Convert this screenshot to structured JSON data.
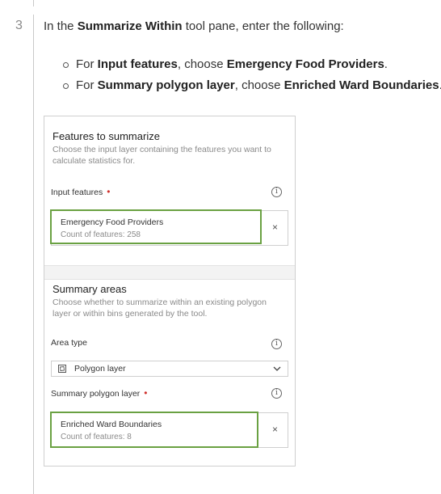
{
  "step": {
    "number": "3",
    "instruction_pre": "In the ",
    "instruction_bold": "Summarize Within",
    "instruction_post": " tool pane, enter the following:",
    "bullets": [
      {
        "pre": "For ",
        "bold1": "Input features",
        "mid": ", choose ",
        "bold2": "Emergency Food Providers",
        "post": "."
      },
      {
        "pre": "For ",
        "bold1": "Summary polygon layer",
        "mid": ", choose ",
        "bold2": "Enriched Ward Boundaries",
        "post": "."
      }
    ]
  },
  "pane": {
    "features_section": {
      "title": "Features to summarize",
      "description": "Choose the input layer containing the features you want to calculate statistics for.",
      "input_label": "Input features",
      "required_mark": "•",
      "input_value": {
        "name": "Emergency Food Providers",
        "count": "Count of features: 258"
      },
      "clear_symbol": "×"
    },
    "summary_section": {
      "title": "Summary areas",
      "description": "Choose whether to summarize within an existing polygon layer or within bins generated by the tool.",
      "area_type_label": "Area type",
      "area_type_value": "Polygon layer",
      "polygon_label": "Summary polygon layer",
      "required_mark": "•",
      "polygon_value": {
        "name": "Enriched Ward Boundaries",
        "count": "Count of features: 8"
      },
      "clear_symbol": "×"
    },
    "info_glyph": "i"
  },
  "colors": {
    "highlight": "#6aa142",
    "required": "#d0312d",
    "muted": "#8a8a8a"
  }
}
